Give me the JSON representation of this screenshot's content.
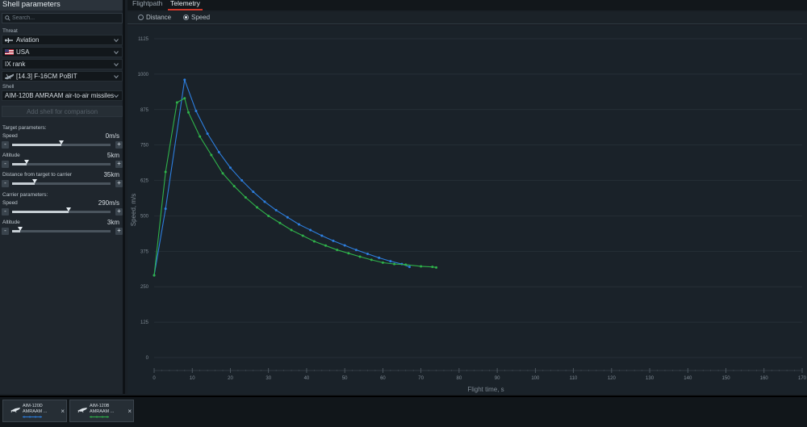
{
  "sidebar": {
    "title": "Shell parameters",
    "search_placeholder": "Search...",
    "threat_label": "Threat",
    "threat": {
      "category": "Aviation",
      "nation": "USA",
      "rank": "IX rank",
      "vehicle": "[14.3] F-16CM PoBIT"
    },
    "shell_label": "Shell",
    "shell": "AIM-120B AMRAAM air-to-air missiles",
    "compare_button": "Add shell for comparison",
    "target_params_label": "Target parameters:",
    "target_speed": {
      "label": "Speed",
      "value": "0m/s",
      "fraction": 0.5
    },
    "target_altitude": {
      "label": "Altitude",
      "value": "5km",
      "fraction": 0.15
    },
    "target_distance": {
      "label": "Distance from target to carrier",
      "value": "35km",
      "fraction": 0.23
    },
    "carrier_params_label": "Carrier parameters:",
    "carrier_speed": {
      "label": "Speed",
      "value": "290m/s",
      "fraction": 0.57
    },
    "carrier_altitude": {
      "label": "Altitude",
      "value": "3km",
      "fraction": 0.08
    }
  },
  "tabs": [
    {
      "label": "Flightpath",
      "active": false
    },
    {
      "label": "Telemetry",
      "active": true
    }
  ],
  "radios": [
    {
      "label": "Distance",
      "selected": false
    },
    {
      "label": "Speed",
      "selected": true
    }
  ],
  "compare_cards": [
    {
      "name": "AIM-120D AMRAAM ...",
      "color": "#2d7fe0"
    },
    {
      "name": "AIM-120B AMRAAM ...",
      "color": "#2fb24a"
    }
  ],
  "colors": {
    "accent_tab": "#d0392b",
    "series_blue": "#2d7fe0",
    "series_green": "#2fb24a"
  },
  "chart_data": {
    "type": "line",
    "xlabel": "Flight time, s",
    "ylabel": "Speed, m/s",
    "xlim": [
      0,
      170
    ],
    "ylim": [
      0,
      1125
    ],
    "xticks": [
      0,
      10,
      20,
      30,
      40,
      50,
      60,
      70,
      80,
      90,
      100,
      110,
      120,
      130,
      140,
      150,
      160,
      170
    ],
    "yticks": [
      0,
      125,
      250,
      375,
      500,
      625,
      750,
      875,
      1000,
      1125
    ],
    "grid": true,
    "series": [
      {
        "color": "#2d7fe0",
        "x": [
          0,
          3,
          8,
          11,
          14,
          17,
          20,
          23,
          26,
          29,
          32,
          35,
          38,
          41,
          44,
          47,
          50,
          53,
          56,
          59,
          62,
          65,
          67
        ],
        "y": [
          290,
          525,
          980,
          870,
          790,
          725,
          670,
          625,
          585,
          550,
          520,
          495,
          470,
          450,
          430,
          412,
          396,
          380,
          366,
          352,
          340,
          330,
          320
        ]
      },
      {
        "color": "#2fb24a",
        "x": [
          0,
          3,
          6,
          8,
          9,
          12,
          15,
          18,
          21,
          24,
          27,
          30,
          33,
          36,
          39,
          42,
          45,
          48,
          51,
          54,
          57,
          60,
          63,
          66,
          70,
          73,
          74
        ],
        "y": [
          290,
          655,
          900,
          915,
          865,
          780,
          715,
          650,
          605,
          565,
          530,
          500,
          475,
          450,
          430,
          410,
          395,
          380,
          368,
          356,
          345,
          335,
          330,
          328,
          322,
          320,
          318
        ]
      }
    ]
  }
}
